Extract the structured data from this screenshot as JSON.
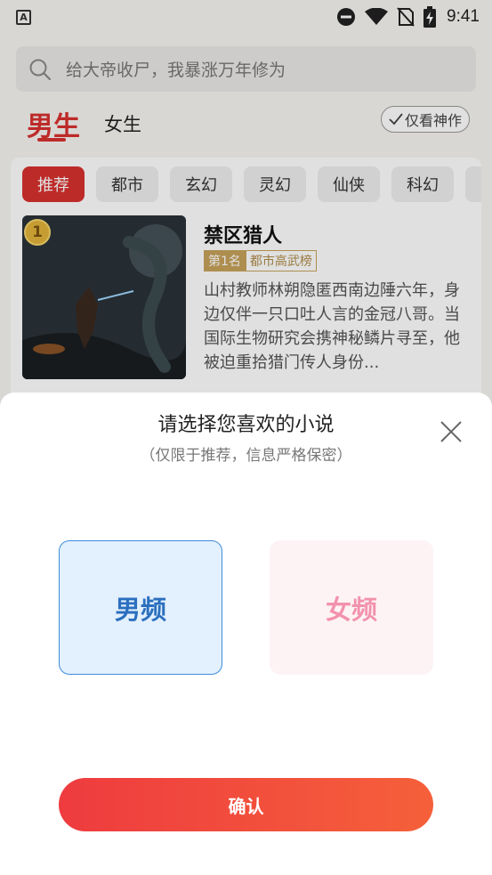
{
  "status_bar": {
    "time": "9:41"
  },
  "search": {
    "placeholder": "给大帝收尸，我暴涨万年修为"
  },
  "gender_tabs": {
    "male": "男生",
    "female": "女生",
    "only_god": "仅看神作"
  },
  "categories": [
    "推荐",
    "都市",
    "玄幻",
    "灵幻",
    "仙侠",
    "科幻"
  ],
  "book": {
    "rank": "1",
    "title": "禁区猎人",
    "rank_label": "第1名",
    "rank_list": "都市高武榜",
    "description": "山村教师林朔隐匿西南边陲六年，身边仅伴一只口吐人言的金冠八哥。当国际生物研究会携神秘鳞片寻至，他被迫重拾猎门传人身份..."
  },
  "dialog": {
    "title": "请选择您喜欢的小说",
    "subtitle": "（仅限于推荐，信息严格保密）",
    "options": {
      "male": "男频",
      "female": "女频"
    },
    "confirm": "确认"
  },
  "colors": {
    "accent_red": "#d8322f",
    "male_blue": "#2b6fbf",
    "female_pink": "#f292ad",
    "confirm_start": "#ee3b3f",
    "confirm_end": "#f5603a"
  },
  "icons": [
    "app-a-icon",
    "dnd-icon",
    "wifi-icon",
    "no-sim-icon",
    "battery-charging-icon",
    "search-icon",
    "check-icon",
    "close-icon",
    "rank-medal-icon"
  ]
}
